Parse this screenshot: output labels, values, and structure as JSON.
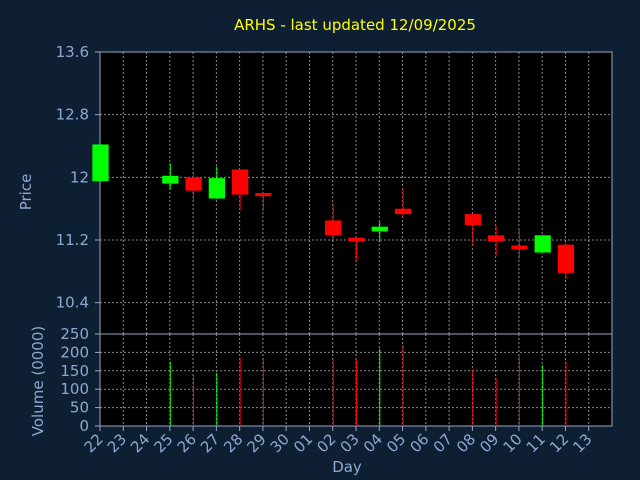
{
  "title": "ARHS - last updated 12/09/2025",
  "colors": {
    "background": "#0f1f33",
    "plot_background": "#000000",
    "axis": "#9aa6c0",
    "grid": "#8c8c8c",
    "label": "#8fa8d0",
    "title": "#ffff00",
    "up": "#00ff00",
    "down": "#ff0000"
  },
  "chart_data": [
    {
      "type": "candlestick",
      "ylabel": "Price",
      "ylim": [
        10.0,
        13.6
      ],
      "yticks": [
        "10.4",
        "11.2",
        "12",
        "12.8",
        "13.6"
      ],
      "grid": true,
      "candles": [
        {
          "day": "22",
          "open": 11.95,
          "high": 12.42,
          "low": 11.95,
          "close": 12.42
        },
        {
          "day": "25",
          "open": 11.92,
          "high": 12.18,
          "low": 11.85,
          "close": 12.02
        },
        {
          "day": "26",
          "open": 12.0,
          "high": 12.05,
          "low": 11.7,
          "close": 11.83
        },
        {
          "day": "27",
          "open": 11.73,
          "high": 12.14,
          "low": 11.72,
          "close": 11.99
        },
        {
          "day": "28",
          "open": 12.1,
          "high": 12.1,
          "low": 11.58,
          "close": 11.78
        },
        {
          "day": "29",
          "open": 11.8,
          "high": 11.81,
          "low": 11.57,
          "close": 11.76
        },
        {
          "day": "02",
          "open": 11.45,
          "high": 11.67,
          "low": 11.21,
          "close": 11.26
        },
        {
          "day": "03",
          "open": 11.23,
          "high": 11.23,
          "low": 10.94,
          "close": 11.18
        },
        {
          "day": "04",
          "open": 11.31,
          "high": 11.43,
          "low": 11.17,
          "close": 11.37
        },
        {
          "day": "05",
          "open": 11.6,
          "high": 11.86,
          "low": 11.48,
          "close": 11.53
        },
        {
          "day": "08",
          "open": 11.53,
          "high": 11.53,
          "low": 11.14,
          "close": 11.39
        },
        {
          "day": "09",
          "open": 11.26,
          "high": 11.38,
          "low": 11.0,
          "close": 11.18
        },
        {
          "day": "10",
          "open": 11.13,
          "high": 11.33,
          "low": 10.96,
          "close": 11.08
        },
        {
          "day": "11",
          "open": 11.04,
          "high": 11.26,
          "low": 11.04,
          "close": 11.26
        },
        {
          "day": "12",
          "open": 11.14,
          "high": 11.14,
          "low": 10.7,
          "close": 10.78
        }
      ]
    },
    {
      "type": "bar",
      "ylabel": "Volume (0000)",
      "xlabel": "Day",
      "ylim": [
        0,
        250
      ],
      "yticks": [
        "0",
        "50",
        "100",
        "150",
        "200",
        "250"
      ],
      "grid": true,
      "categories": [
        "22",
        "23",
        "24",
        "25",
        "26",
        "27",
        "28",
        "29",
        "30",
        "01",
        "02",
        "03",
        "04",
        "05",
        "06",
        "07",
        "08",
        "09",
        "10",
        "11",
        "12",
        "13"
      ],
      "values": [
        0,
        0,
        0,
        175,
        140,
        145,
        185,
        185,
        0,
        0,
        180,
        180,
        210,
        220,
        0,
        0,
        155,
        130,
        190,
        165,
        175,
        0
      ]
    }
  ]
}
